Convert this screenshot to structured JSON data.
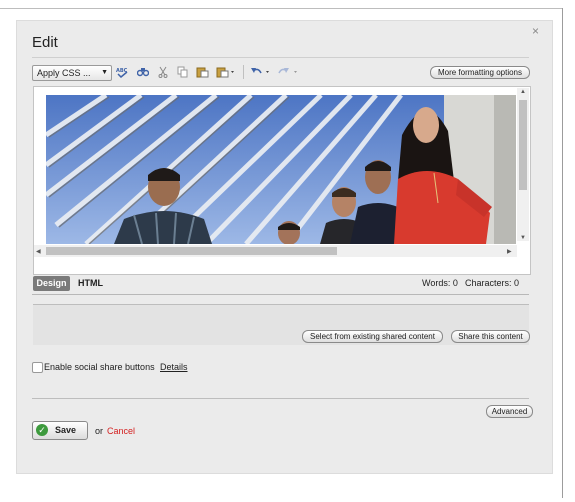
{
  "dialog": {
    "title": "Edit",
    "close_glyph": "×"
  },
  "toolbar": {
    "style_select": "Apply CSS ...",
    "icons": [
      "spellcheck-icon",
      "find-icon",
      "cut-icon",
      "copy-icon",
      "paste-icon",
      "paste-special-icon",
      "undo-icon",
      "redo-icon"
    ],
    "more_formatting": "More formatting options"
  },
  "editor": {
    "image_description_icon": "photo-group-on-bridge"
  },
  "modes": {
    "design": "Design",
    "html": "HTML"
  },
  "counts": {
    "words": "Words: 0",
    "characters": "Characters: 0"
  },
  "shared_content": {
    "select_existing": "Select from existing shared content",
    "share_this": "Share this content"
  },
  "social": {
    "label": "Enable social share buttons",
    "details": "Details"
  },
  "advanced": "Advanced",
  "footer": {
    "save": "Save",
    "or": "or",
    "cancel": "Cancel"
  },
  "colors": {
    "dialog_bg": "#ebebeb",
    "cancel": "#d42020",
    "save_check": "#3d9a3d",
    "design_tab": "#7a7a7a"
  }
}
